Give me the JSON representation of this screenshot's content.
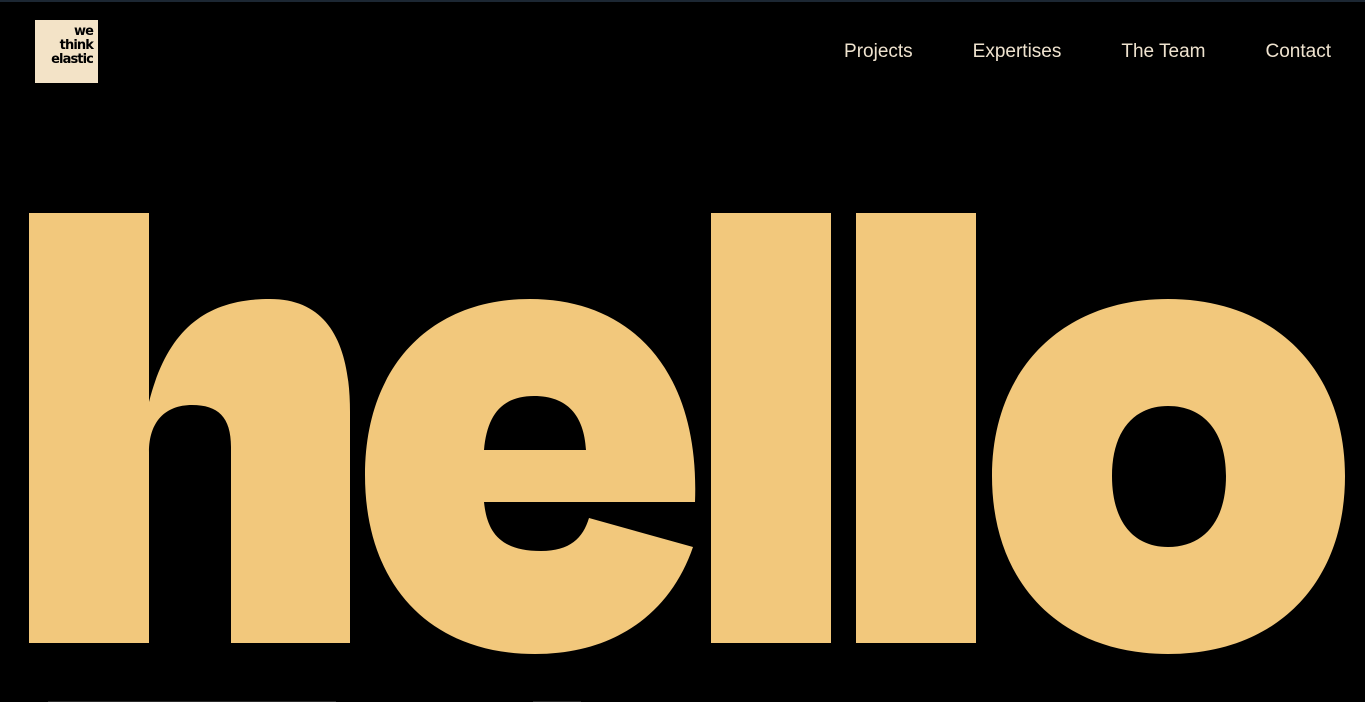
{
  "brand": {
    "logo_lines": [
      "we",
      "think",
      "elastic"
    ],
    "logo_bg": "#f3e3c7"
  },
  "nav": {
    "items": [
      "Projects",
      "Expertises",
      "The Team",
      "Contact"
    ]
  },
  "hero": {
    "word": "hello",
    "color": "#f2c87c"
  },
  "colors": {
    "background": "#000000",
    "nav_text": "#efe3cf"
  }
}
